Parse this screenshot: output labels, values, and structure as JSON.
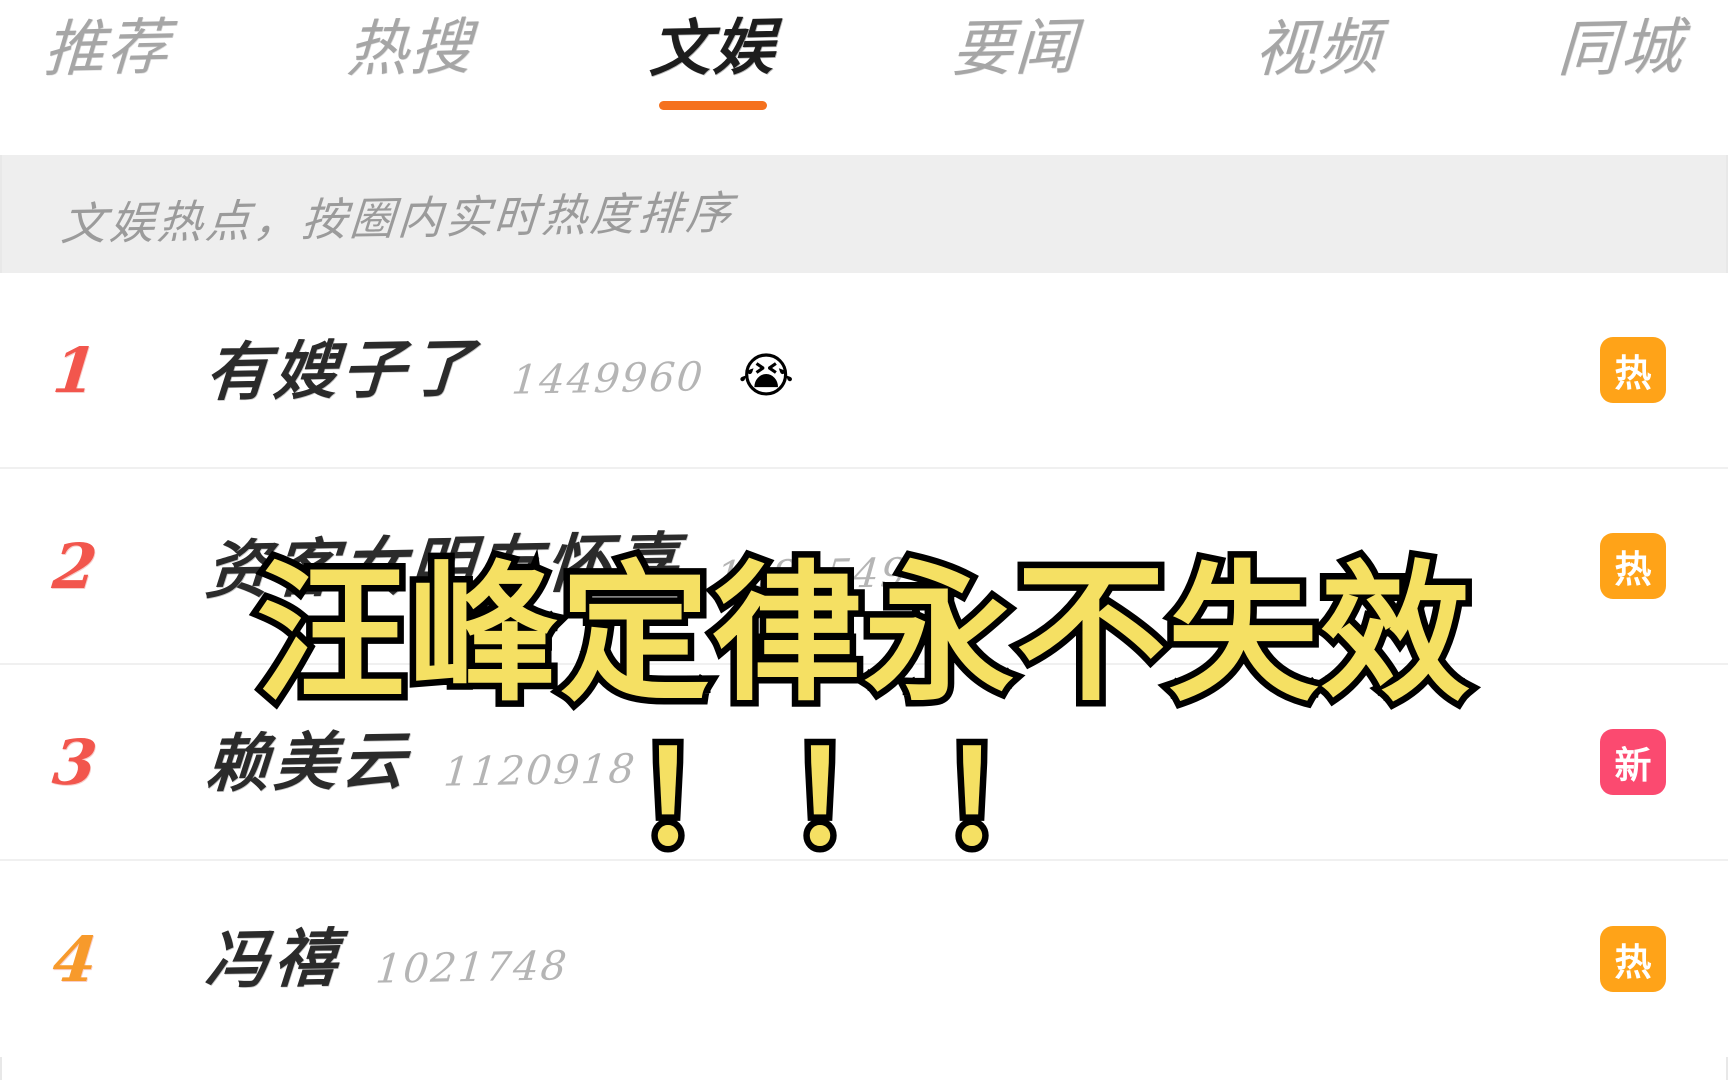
{
  "tabs": [
    {
      "label": "推荐",
      "active": false
    },
    {
      "label": "热搜",
      "active": false
    },
    {
      "label": "文娱",
      "active": true
    },
    {
      "label": "要闻",
      "active": false
    },
    {
      "label": "视频",
      "active": false
    },
    {
      "label": "同城",
      "active": false
    }
  ],
  "subtitle": "文娱热点，按圈内实时热度排序",
  "accent_color": "#f5711e",
  "badge_hot_color": "#ffa318",
  "badge_new_color": "#fb4a70",
  "caption_text_color": "#f5e063",
  "rows": [
    {
      "rank": "1",
      "rank_style": "hot",
      "title": "有嫂子了",
      "count": "1449960",
      "emoji": "😭",
      "badge": "热",
      "badge_type": "hot"
    },
    {
      "rank": "2",
      "rank_style": "hot",
      "title": "资客女明友怀喜",
      "count": "1281549",
      "emoji": "",
      "badge": "热",
      "badge_type": "hot"
    },
    {
      "rank": "3",
      "rank_style": "hot",
      "title": "赖美云",
      "count": "1120918",
      "emoji": "",
      "badge": "新",
      "badge_type": "new"
    },
    {
      "rank": "4",
      "rank_style": "warm",
      "title": "冯禧",
      "count": "1021748",
      "emoji": "",
      "badge": "热",
      "badge_type": "hot"
    }
  ],
  "caption": {
    "main": "汪峰定律永不失效",
    "marks": "！！！"
  }
}
